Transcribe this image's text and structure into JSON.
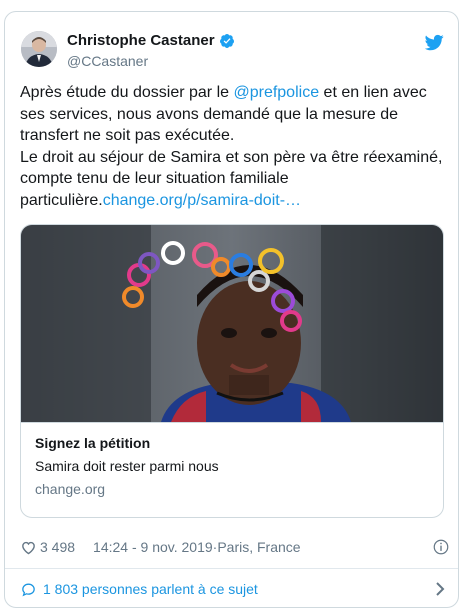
{
  "tweet": {
    "author_name": "Christophe Castaner",
    "author_handle": "@CCastaner",
    "text_part1": "Après étude du dossier par le ",
    "mention": "@prefpolice",
    "text_part2": " et en lien avec ses services, nous avons demandé que la mesure de transfert ne soit pas exécutée.",
    "text_part3": "Le droit au séjour de Samira et son père va être réexaminé, compte tenu de leur situation familiale particulière.",
    "link_text": "change.org/p/samira-doit-…"
  },
  "link_card": {
    "title": "Signez la pétition",
    "description": "Samira doit rester parmi nous",
    "domain": "change.org"
  },
  "meta": {
    "likes": "3 498",
    "timestamp": "14:24 - 9 nov. 2019",
    "separator": " · ",
    "location": "Paris, France"
  },
  "discussion": {
    "label": "1 803 personnes parlent à ce sujet"
  },
  "colors": {
    "link": "#1b95e0",
    "secondary_text": "#657786",
    "border": "#cfd9de"
  },
  "icons": [
    "verified-icon",
    "twitter-bird-icon",
    "heart-icon",
    "info-icon",
    "speech-bubble-icon",
    "chevron-right-icon"
  ]
}
